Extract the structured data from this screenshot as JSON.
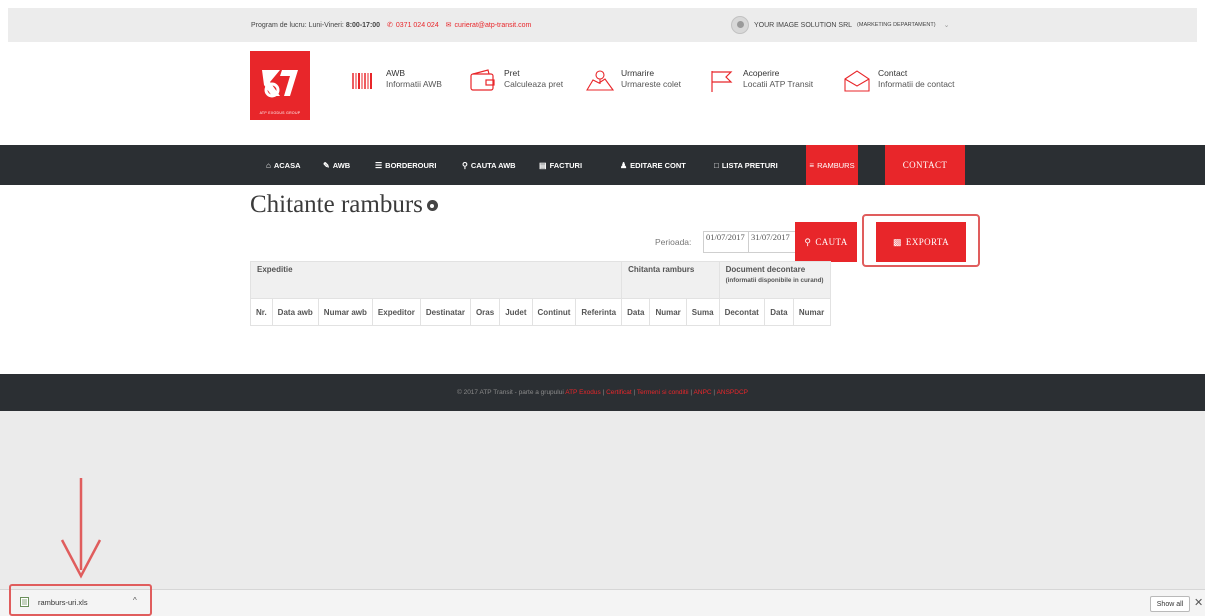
{
  "topbar": {
    "hours_label": "Program de lucru: Luni-Vineri: ",
    "hours_value": "8:00-17:00",
    "phone": "0371 024 024",
    "email": "curierat@atp-transit.com",
    "company": "YOUR IMAGE SOLUTION SRL",
    "department": "(MARKETING DEPARTAMENT)"
  },
  "logo": {
    "text": "ATP EXODUS GROUP"
  },
  "features": [
    {
      "title": "AWB",
      "subtitle": "Informatii AWB",
      "icon": "barcode-icon"
    },
    {
      "title": "Pret",
      "subtitle": "Calculeaza pret",
      "icon": "wallet-icon"
    },
    {
      "title": "Urmarire",
      "subtitle": "Urmareste colet",
      "icon": "map-icon"
    },
    {
      "title": "Acoperire",
      "subtitle": "Locatii ATP Transit",
      "icon": "flag-icon"
    },
    {
      "title": "Contact",
      "subtitle": "Informatii de contact",
      "icon": "envelope-icon"
    }
  ],
  "nav": {
    "acasa": "ACASA",
    "awb": "AWB",
    "borderouri": "BORDEROURI",
    "cauta_awb": "CAUTA AWB",
    "facturi": "FACTURI",
    "editare_cont": "EDITARE CONT",
    "lista_preturi": "LISTA PRETURI",
    "ramburs": "RAMBURS",
    "contact": "CONTACT"
  },
  "page": {
    "title": "Chitante ramburs"
  },
  "filter": {
    "period_label": "Perioada:",
    "date_from": "01/07/2017",
    "date_to": "31/07/2017",
    "search_button": "CAUTA",
    "export_button": "EXPORTA"
  },
  "table": {
    "group_headers": {
      "expeditie": "Expeditie",
      "chitanta": "Chitanta ramburs",
      "document": "Document decontare",
      "document_note": "(informatii disponibile in curand)"
    },
    "columns": [
      "Nr.",
      "Data awb",
      "Numar awb",
      "Expeditor",
      "Destinatar",
      "Oras",
      "Judet",
      "Continut",
      "Referinta",
      "Data",
      "Numar",
      "Suma",
      "Decontat",
      "Data",
      "Numar"
    ]
  },
  "footer": {
    "prefix": "© 2017 ATP Transit - parte a grupului ",
    "link_group": "ATP Exodus",
    "sep": " | ",
    "link_cert": "Certificat",
    "link_terms": "Termeni si conditii",
    "link_anpc": "ANPC",
    "link_anspdcp": "ANSPDCP"
  },
  "download_bar": {
    "file_name": "ramburs-uri.xls",
    "show_all": "Show all",
    "close": "✕",
    "chevron": "^"
  },
  "colors": {
    "accent": "#e8262a",
    "nav_bg": "#2b2f33",
    "annotation": "#e05d5d"
  }
}
